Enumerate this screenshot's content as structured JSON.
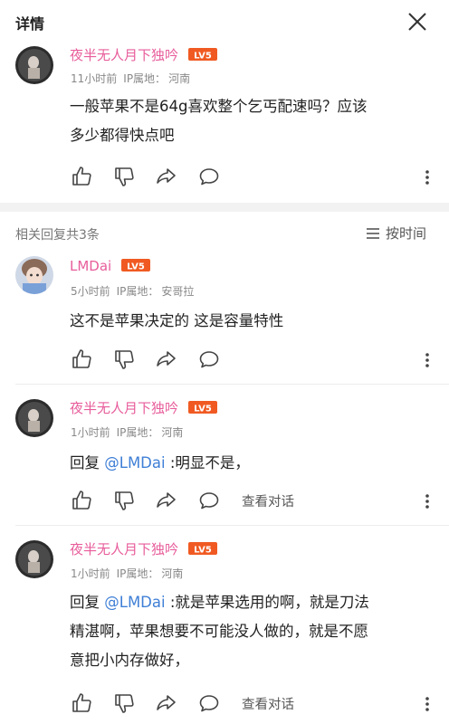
{
  "header": {
    "title": "详情"
  },
  "main_comment": {
    "username": "夜半无人月下独吟",
    "level": "LV5",
    "time": "11小时前",
    "ip_label": "IP属地：",
    "ip_location": "河南",
    "text_line1": "一般苹果不是64g喜欢整个乞丐配速吗？应该",
    "text_line2": "多少都得快点吧"
  },
  "replies_header": {
    "count_label": "相关回复共3条",
    "sort_label": "按时间"
  },
  "replies": [
    {
      "username": "LMDai",
      "level": "LV5",
      "time": "5小时前",
      "ip_label": "IP属地：",
      "ip_location": "安哥拉",
      "text": "这不是苹果决定的 这是容量特性"
    },
    {
      "username": "夜半无人月下独吟",
      "level": "LV5",
      "time": "1小时前",
      "ip_label": "IP属地：",
      "ip_location": "河南",
      "reply_prefix": "回复 ",
      "mention": "@LMDai",
      "text": " :明显不是，",
      "view_conversation": "查看对话"
    },
    {
      "username": "夜半无人月下独吟",
      "level": "LV5",
      "time": "1小时前",
      "ip_label": "IP属地：",
      "ip_location": "河南",
      "reply_prefix": "回复 ",
      "mention": "@LMDai",
      "text_line1": " :就是苹果选用的啊，就是刀法",
      "text_line2": "精湛啊，苹果想要不可能没人做的，就是不愿",
      "text_line3": "意把小内存做好，",
      "view_conversation": "查看对话"
    }
  ],
  "colors": {
    "username": "#e85d9b",
    "level_badge": "#f05a22",
    "mention": "#3f7fd6",
    "meta": "#888888"
  },
  "icons": [
    "close-icon",
    "like-icon",
    "dislike-icon",
    "share-icon",
    "comment-icon",
    "more-icon",
    "sort-icon",
    "level-badge-icon"
  ]
}
